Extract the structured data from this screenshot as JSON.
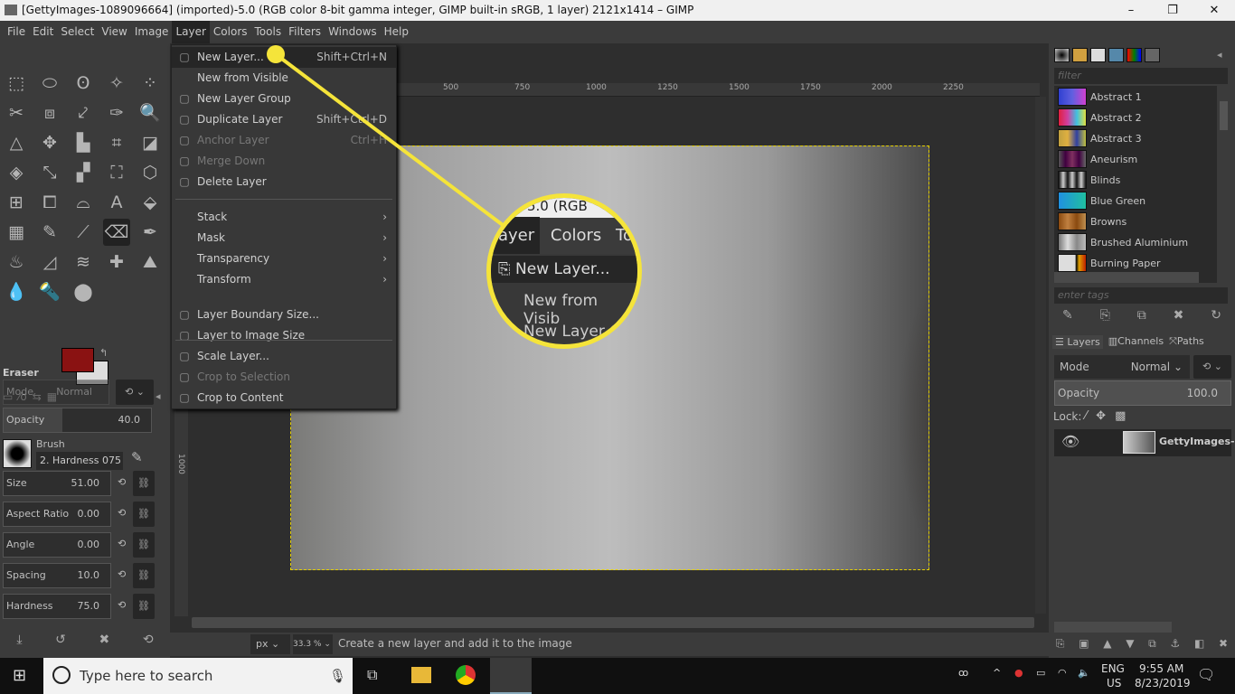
{
  "window": {
    "title": "[GettyImages-1089096664] (imported)-5.0 (RGB color 8-bit gamma integer, GIMP built-in sRGB, 1 layer) 2121x1414 – GIMP",
    "minimize": "–",
    "maximize": "❐",
    "close": "✕"
  },
  "menubar": [
    "File",
    "Edit",
    "Select",
    "View",
    "Image",
    "Layer",
    "Colors",
    "Tools",
    "Filters",
    "Windows",
    "Help"
  ],
  "layer_menu": [
    {
      "label": "New Layer...",
      "shortcut": "Shift+Ctrl+N",
      "icon": "new-layer-icon",
      "state": "highlighted"
    },
    {
      "label": "New from Visible",
      "shortcut": "",
      "icon": "",
      "state": "enabled"
    },
    {
      "label": "New Layer Group",
      "shortcut": "",
      "icon": "folder-plus-icon",
      "state": "enabled"
    },
    {
      "label": "Duplicate Layer",
      "shortcut": "Shift+Ctrl+D",
      "icon": "duplicate-icon",
      "state": "enabled"
    },
    {
      "label": "Anchor Layer",
      "shortcut": "Ctrl+H",
      "icon": "anchor-icon",
      "state": "disabled"
    },
    {
      "label": "Merge Down",
      "shortcut": "",
      "icon": "merge-down-icon",
      "state": "disabled"
    },
    {
      "label": "Delete Layer",
      "shortcut": "",
      "icon": "delete-icon",
      "state": "enabled"
    },
    {
      "label": "Stack",
      "submenu": true
    },
    {
      "label": "Mask",
      "submenu": true
    },
    {
      "label": "Transparency",
      "submenu": true
    },
    {
      "label": "Transform",
      "submenu": true
    },
    {
      "label": "Layer Boundary Size...",
      "icon": "boundary-icon",
      "state": "enabled"
    },
    {
      "label": "Layer to Image Size",
      "icon": "fit-icon",
      "state": "enabled"
    },
    {
      "label": "Scale Layer...",
      "icon": "scale-icon",
      "state": "enabled"
    },
    {
      "label": "Crop to Selection",
      "icon": "crop-icon",
      "state": "disabled"
    },
    {
      "label": "Crop to Content",
      "icon": "crop-icon",
      "state": "enabled"
    }
  ],
  "magnifier": {
    "title_fragment": "5.0 (RGB",
    "menu": [
      "ayer",
      "Colors",
      "To"
    ],
    "items": [
      "New Layer...",
      "New from Visib",
      "New Layer G"
    ]
  },
  "ruler": {
    "h": [
      "500",
      "750",
      "1000",
      "1250",
      "1500",
      "1750",
      "2000",
      "2250"
    ],
    "v": "1000"
  },
  "tool_options": {
    "title": "Eraser",
    "mode_label": "Mode",
    "mode_value": "Normal",
    "opacity_label": "Opacity",
    "opacity_value": "40.0",
    "opacity": 40,
    "brush_label": "Brush",
    "brush_value": "2. Hardness 075",
    "sliders": [
      {
        "label": "Size",
        "value": "51.00"
      },
      {
        "label": "Aspect Ratio",
        "value": "0.00"
      },
      {
        "label": "Angle",
        "value": "0.00"
      },
      {
        "label": "Spacing",
        "value": "10.0"
      },
      {
        "label": "Hardness",
        "value": "75.0"
      }
    ]
  },
  "colors": {
    "foreground": "#8a1212",
    "background": "#dddddd",
    "accent": "#f5e43a"
  },
  "gradients": {
    "filter_placeholder": "filter",
    "tags_placeholder": "enter tags",
    "items": [
      {
        "name": "Abstract 1",
        "g": "linear-gradient(90deg,#3040d0,#6060e0,#d040d0)"
      },
      {
        "name": "Abstract 2",
        "g": "linear-gradient(90deg,#e02040,#d040a0,#40c0e0,#e0e040)"
      },
      {
        "name": "Abstract 3",
        "g": "linear-gradient(90deg,#c0a040,#e0b040,#3040a0,#c0c040)"
      },
      {
        "name": "Aneurism",
        "g": "linear-gradient(90deg,#555,#400040,#803060,#400040,#666)"
      },
      {
        "name": "Blinds",
        "g": "repeating-linear-gradient(90deg,#111,#ccc 5px,#111 10px)"
      },
      {
        "name": "Blue Green",
        "g": "linear-gradient(90deg,#2090e0,#20c0a0)"
      },
      {
        "name": "Browns",
        "g": "linear-gradient(90deg,#8a4a10,#c08040,#8a4a10,#c09050)"
      },
      {
        "name": "Brushed Aluminium",
        "g": "linear-gradient(90deg,#777,#ddd,#888,#bbb)"
      },
      {
        "name": "Burning Paper",
        "g": "linear-gradient(90deg,#ddd 60%,#000 65%,#e0a000 75%,#c02000)"
      }
    ]
  },
  "layers_panel": {
    "tabs": [
      "Layers",
      "Channels",
      "Paths"
    ],
    "mode_label": "Mode",
    "mode_value": "Normal",
    "opacity_label": "Opacity",
    "opacity_value": "100.0",
    "lock_label": "Lock:",
    "layer_name": "GettyImages-"
  },
  "status": {
    "unit": "px",
    "zoom": "33.3 %",
    "message": "Create a new layer and add it to the image"
  },
  "taskbar": {
    "search_placeholder": "Type here to search",
    "lang_top": "ENG",
    "lang_bottom": "US",
    "time": "9:55 AM",
    "date": "8/23/2019"
  }
}
